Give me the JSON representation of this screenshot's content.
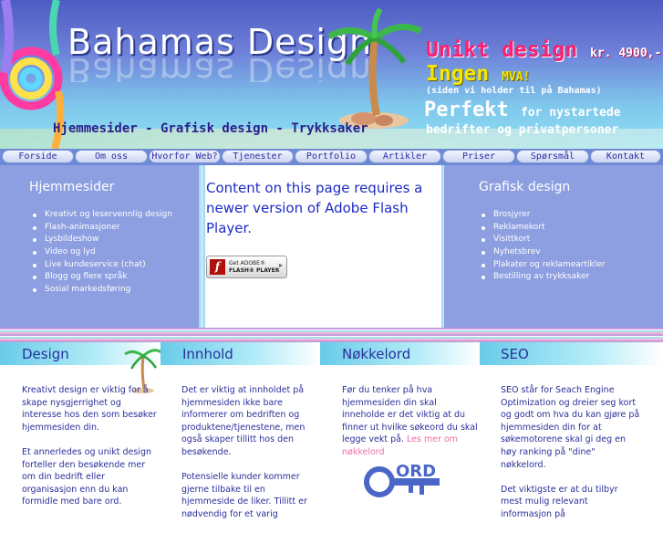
{
  "header": {
    "logo": "Bahamas Design",
    "tagline": "Hjemmesider - Grafisk design - Trykksaker",
    "promo": {
      "line1_main": "Unikt design",
      "line1_price": "kr. 4900,-",
      "line2_main": "Ingen",
      "line2_small": "MVA!",
      "line3": "(siden vi holder til på Bahamas)",
      "line4_main": "Perfekt",
      "line4_small": "for nystartede",
      "line5": "bedrifter og privatpersoner"
    }
  },
  "nav": {
    "items": [
      "Forside",
      "Om oss",
      "Hvorfor Web?",
      "Tjenester",
      "Portfolio",
      "Artikler",
      "Priser",
      "Spørsmål",
      "Kontakt"
    ]
  },
  "left_panel": {
    "title": "Hjemmesider",
    "items": [
      "Kreativt og leservennlig design",
      "Flash-animasjoner",
      "Lysbildeshow",
      "Video og lyd",
      "Live kundeservice (chat)",
      "Blogg og flere språk",
      "Sosial markedsføring"
    ]
  },
  "flash": {
    "message": "Content on this page requires a newer version of Adobe Flash Player.",
    "badge_line1": "Get ADOBE®",
    "badge_line2": "FLASH® PLAYER"
  },
  "right_panel": {
    "title": "Grafisk design",
    "items": [
      "Brosjyrer",
      "Reklamekort",
      "Visittkort",
      "Nyhetsbrev",
      "Plakater og reklameartikler",
      "Bestilling av trykksaker"
    ]
  },
  "columns": {
    "design": {
      "title": "Design",
      "p1": "Kreativt design er viktig for å skape nysgjerrighet og interesse hos den som besøker hjemmesiden din.",
      "p2": "Et annerledes og unikt design forteller den besøkende mer om din bedrift eller organisasjon enn du kan formidle med bare ord."
    },
    "innhold": {
      "title": "Innhold",
      "p1": "Det er viktig at innholdet på hjemmesiden ikke bare informerer om bedriften og produktene/tjenestene, men også skaper tillitt hos den besøkende.",
      "p2": "Potensielle kunder kommer gjerne tilbake til en hjemmeside de liker. Tillitt er nødvendig for et varig"
    },
    "nokkelord": {
      "title": "Nøkkelord",
      "p1": "Før du tenker på hva hjemmesiden din skal inneholde er det viktig at du finner ut hvilke søkeord du skal legge vekt på.",
      "link": "Les mer om nøkkelord",
      "image_text": "ORD"
    },
    "seo": {
      "title": "SEO",
      "p1": "SEO står for Seach Engine Optimization og dreier seg kort og godt om hva du kan gjøre på hjemmesiden din for at søkemotorene skal gi deg en høy ranking på \"dine\" nøkkelord.",
      "p2": "Det viktigste er at du tilbyr mest mulig relevant informasjon på"
    }
  },
  "colors": {
    "header_blue": "#5566c8",
    "panel_blue": "#8d9fe0",
    "heading_navy": "#2b2f9a",
    "flash_text": "#1d2bc4",
    "promo_pink": "#ff1f6e",
    "promo_yellow": "#f4e700",
    "link_pink": "#f06ca8"
  }
}
